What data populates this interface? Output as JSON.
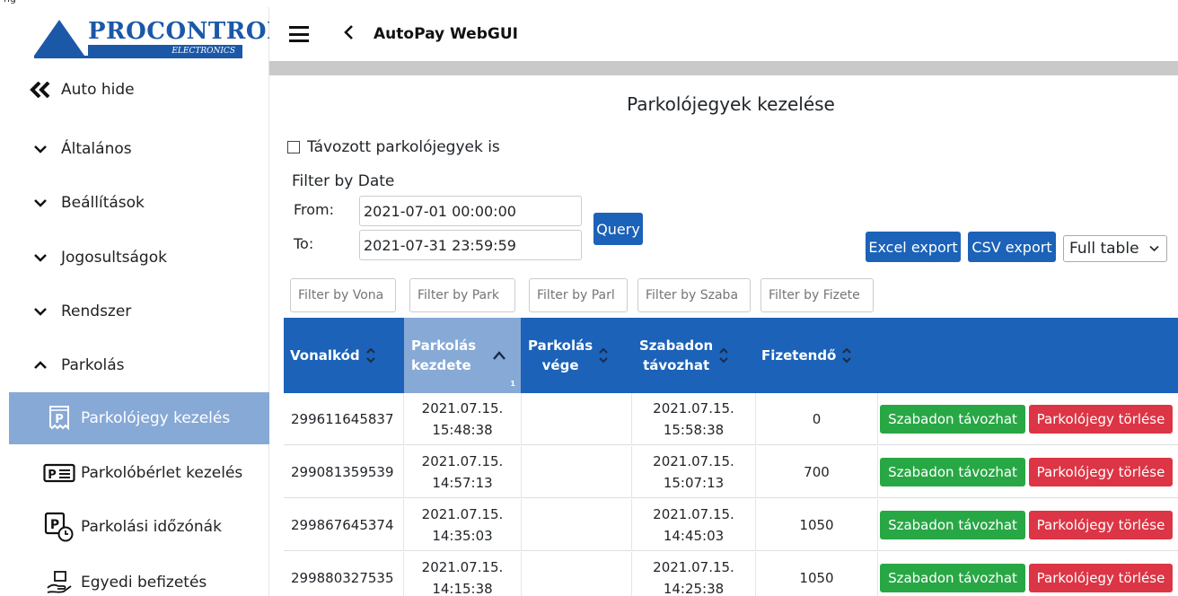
{
  "top_label": "ng",
  "logo": {
    "brand": "PROCONTROL",
    "sub": "ELECTRONICS"
  },
  "header": {
    "title": "AutoPay WebGUI"
  },
  "sidebar": {
    "auto_hide": "Auto hide",
    "sections": [
      {
        "label": "Általános",
        "expanded": false
      },
      {
        "label": "Beállítások",
        "expanded": false
      },
      {
        "label": "Jogosultságok",
        "expanded": false
      },
      {
        "label": "Rendszer",
        "expanded": false
      },
      {
        "label": "Parkolás",
        "expanded": true
      }
    ],
    "subitems": [
      {
        "label": "Parkolójegy kezelés",
        "icon": "parking-ticket-icon",
        "active": true
      },
      {
        "label": "Parkolóbérlet kezelés",
        "icon": "parking-pass-icon",
        "active": false
      },
      {
        "label": "Parkolási időzónák",
        "icon": "parking-timezone-icon",
        "active": false
      },
      {
        "label": "Egyedi befizetés",
        "icon": "payment-hand-icon",
        "active": false
      }
    ]
  },
  "page": {
    "title": "Parkolójegyek kezelése",
    "checkbox_label": "Távozott parkolójegyek is",
    "filter_by_date": "Filter by Date",
    "from_label": "From:",
    "to_label": "To:",
    "from_value": "2021-07-01 00:00:00",
    "to_value": "2021-07-31 23:59:59",
    "query_label": "Query",
    "excel_label": "Excel export",
    "csv_label": "CSV export",
    "view_select": "Full table"
  },
  "filters": [
    "Filter by Vona",
    "Filter by Park",
    "Filter by Parl",
    "Filter by Szaba",
    "Filter by Fizete"
  ],
  "table": {
    "headers": [
      {
        "line1": "Vonalkód",
        "line2": ""
      },
      {
        "line1": "Parkolás",
        "line2": "kezdete",
        "sort_index": "1"
      },
      {
        "line1": "Parkolás",
        "line2": "vége"
      },
      {
        "line1": "Szabadon",
        "line2": "távozhat"
      },
      {
        "line1": "Fizetendő",
        "line2": ""
      }
    ],
    "action_free": "Szabadon távozhat",
    "action_delete": "Parkolójegy törlése",
    "rows": [
      {
        "barcode": "299611645837",
        "start_date": "2021.07.15.",
        "start_time": "15:48:38",
        "end": "",
        "free_date": "2021.07.15.",
        "free_time": "15:58:38",
        "amount": "0"
      },
      {
        "barcode": "299081359539",
        "start_date": "2021.07.15.",
        "start_time": "14:57:13",
        "end": "",
        "free_date": "2021.07.15.",
        "free_time": "15:07:13",
        "amount": "700"
      },
      {
        "barcode": "299867645374",
        "start_date": "2021.07.15.",
        "start_time": "14:35:03",
        "end": "",
        "free_date": "2021.07.15.",
        "free_time": "14:45:03",
        "amount": "1050"
      },
      {
        "barcode": "299880327535",
        "start_date": "2021.07.15.",
        "start_time": "14:15:38",
        "end": "",
        "free_date": "2021.07.15.",
        "free_time": "14:25:38",
        "amount": "1050"
      }
    ]
  },
  "colors": {
    "primary_blue": "#1b62b8",
    "active_nav": "#87a9d6",
    "success": "#28a745",
    "danger": "#dc3545"
  }
}
